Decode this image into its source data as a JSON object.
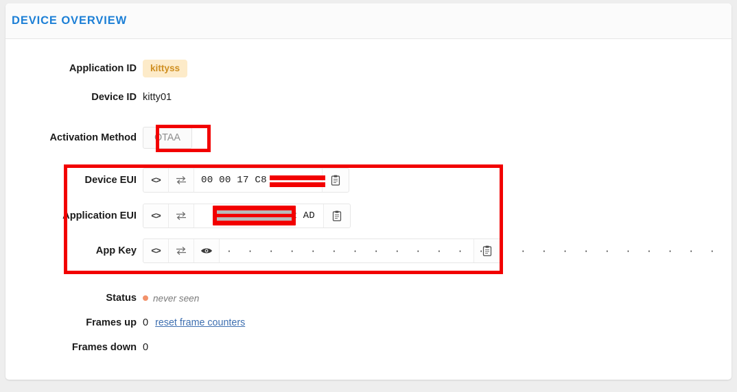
{
  "card": {
    "title": "DEVICE OVERVIEW"
  },
  "fields": {
    "application_id": {
      "label": "Application ID",
      "badge_value": "kittyss"
    },
    "device_id": {
      "label": "Device ID",
      "value": "kitty01"
    },
    "activation_method": {
      "label": "Activation Method",
      "button_value": "OTAA"
    },
    "device_eui": {
      "label": "Device EUI",
      "value": "00 00 17 C8",
      "code_icon": "code-icon",
      "swap_icon": "swap-icon",
      "copy_icon": "clipboard-icon"
    },
    "application_eui": {
      "label": "Application EUI",
      "value": "62 AD",
      "code_icon": "code-icon",
      "swap_icon": "swap-icon",
      "copy_icon": "clipboard-icon"
    },
    "app_key": {
      "label": "App Key",
      "value": "· · · · · · · · · · · · · · · · · · · · · · · · · · · · · · · ·",
      "code_icon": "code-icon",
      "swap_icon": "swap-icon",
      "reveal_icon": "eye-icon",
      "copy_icon": "clipboard-icon"
    },
    "status": {
      "label": "Status",
      "value": "never seen"
    },
    "frames_up": {
      "label": "Frames up",
      "value": "0",
      "link_label": "reset frame counters"
    },
    "frames_down": {
      "label": "Frames down",
      "value": "0"
    }
  },
  "colors": {
    "title_blue": "#1c7fd6",
    "badge_bg": "#fdebc9",
    "badge_fg": "#cf8f21",
    "annotation_red": "#f20000",
    "status_dot": "#f2926b",
    "link_blue": "#3e6fb0"
  }
}
